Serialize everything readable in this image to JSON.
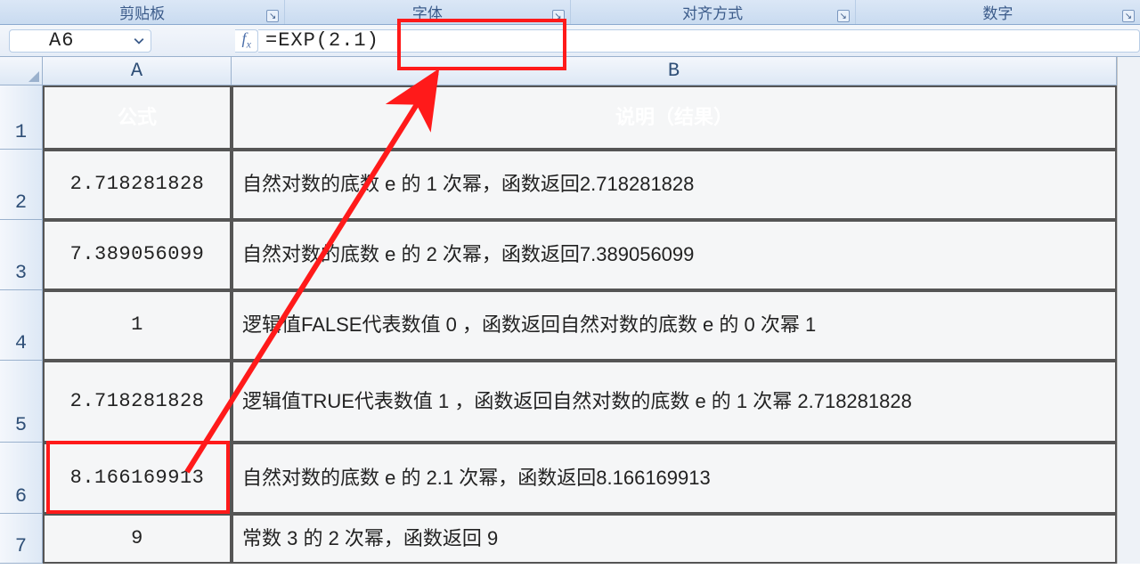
{
  "ribbon": {
    "groups": [
      "剪贴板",
      "字体",
      "对齐方式",
      "数字"
    ]
  },
  "namebox": {
    "value": "A6"
  },
  "fxLabel": "fx",
  "formula": "=EXP(2.1)",
  "columns": [
    "A",
    "B"
  ],
  "headerRow": {
    "A": "公式",
    "B": "说明（结果）"
  },
  "rows": [
    {
      "n": "2",
      "A": "2.718281828",
      "B": "自然对数的底数 e 的 1 次幂，函数返回2.718281828"
    },
    {
      "n": "3",
      "A": "7.389056099",
      "B": "自然对数的底数 e 的 2 次幂，函数返回7.389056099"
    },
    {
      "n": "4",
      "A": "1",
      "B": "逻辑值FALSE代表数值 0 ，函数返回自然对数的底数 e 的 0 次幂 1"
    },
    {
      "n": "5",
      "A": "2.718281828",
      "B": "逻辑值TRUE代表数值 1 ，函数返回自然对数的底数 e 的 1 次幂 2.718281828"
    },
    {
      "n": "6",
      "A": "8.166169913",
      "B": "自然对数的底数 e 的 2.1 次幂，函数返回8.166169913"
    },
    {
      "n": "7",
      "A": "9",
      "B": "常数 3 的 2 次幂，函数返回 9"
    }
  ],
  "highlight": {
    "activeCell": "A6"
  }
}
